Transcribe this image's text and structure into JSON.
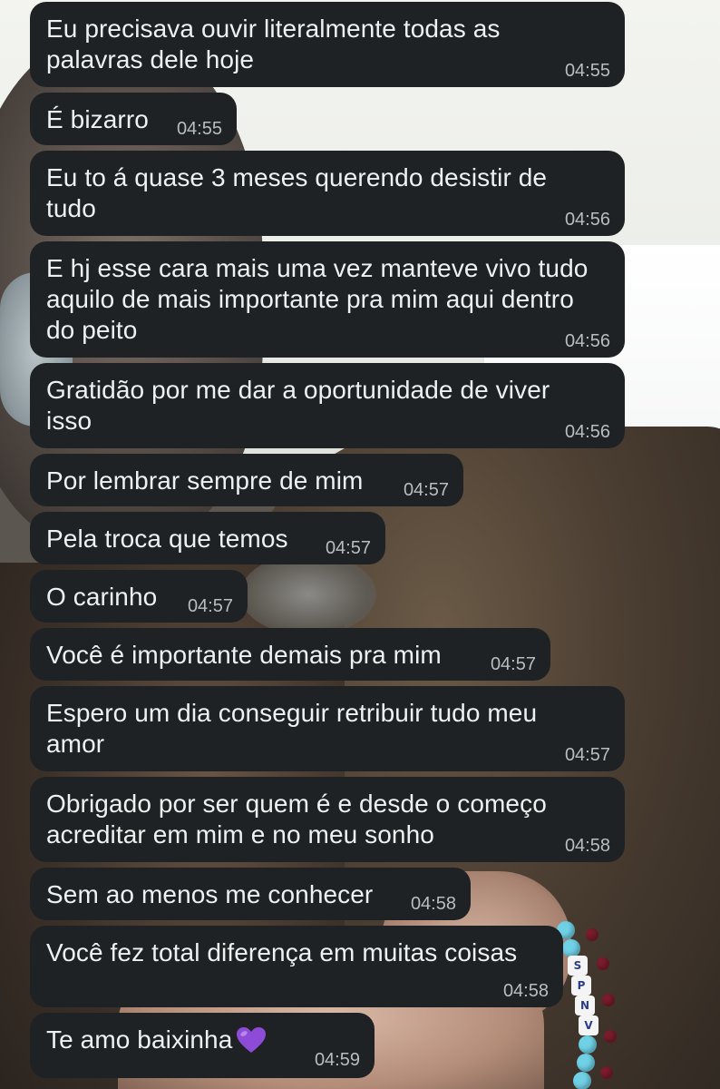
{
  "chat": {
    "messages": [
      {
        "text": "Eu precisava ouvir literalmente todas as\npalavras dele hoje",
        "time": "04:55"
      },
      {
        "text": "É bizarro",
        "time": "04:55"
      },
      {
        "text": "Eu to á quase 3 meses querendo desistir de\ntudo",
        "time": "04:56"
      },
      {
        "text": "E hj esse cara mais uma vez manteve vivo tudo\naquilo de mais importante pra mim aqui dentro\ndo peito",
        "time": "04:56"
      },
      {
        "text": "Gratidão por me dar a oportunidade de viver\nisso",
        "time": "04:56"
      },
      {
        "text": "Por lembrar sempre de mim",
        "time": "04:57"
      },
      {
        "text": "Pela troca que temos",
        "time": "04:57"
      },
      {
        "text": "O carinho",
        "time": "04:57"
      },
      {
        "text": "Você é importante demais pra mim",
        "time": "04:57"
      },
      {
        "text": "Espero um dia conseguir retribuir tudo meu\namor",
        "time": "04:57"
      },
      {
        "text": "Obrigado por ser quem é e desde o começo\nacreditar em mim e no meu sonho",
        "time": "04:58"
      },
      {
        "text": "Sem ao menos me conhecer",
        "time": "04:58"
      },
      {
        "text": "Você fez total diferença em muitas coisas",
        "time": "04:58"
      },
      {
        "text": "Te amo baixinha",
        "time": "04:59",
        "emoji": "purple-heart"
      }
    ]
  },
  "bracelet_letters": [
    "S",
    "P",
    "N",
    "V"
  ],
  "colors": {
    "bubble_bg": "#1e2224",
    "bubble_text": "#eef0f1",
    "timestamp": "#b9bdbf",
    "heart": "#8e4bd8"
  }
}
